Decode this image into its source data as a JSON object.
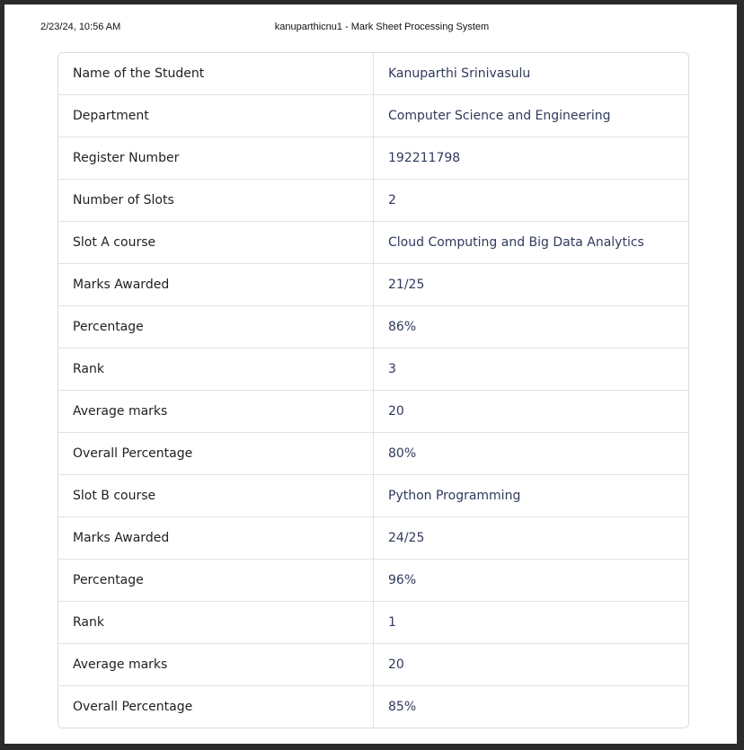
{
  "print_header": {
    "datetime": "2/23/24, 10:56 AM",
    "title": "kanuparthicnu1 - Mark Sheet Processing System"
  },
  "rows": [
    {
      "label": "Name of the Student",
      "value": "Kanuparthi Srinivasulu"
    },
    {
      "label": "Department",
      "value": "Computer Science and Engineering"
    },
    {
      "label": "Register Number",
      "value": "192211798"
    },
    {
      "label": "Number of Slots",
      "value": "2"
    },
    {
      "label": "Slot A course",
      "value": "Cloud Computing and Big Data Analytics"
    },
    {
      "label": "Marks Awarded",
      "value": "21/25"
    },
    {
      "label": "Percentage",
      "value": "86%"
    },
    {
      "label": "Rank",
      "value": "3"
    },
    {
      "label": "Average marks",
      "value": "20"
    },
    {
      "label": "Overall Percentage",
      "value": "80%"
    },
    {
      "label": "Slot B course",
      "value": "Python Programming"
    },
    {
      "label": "Marks Awarded",
      "value": "24/25"
    },
    {
      "label": "Percentage",
      "value": "96%"
    },
    {
      "label": "Rank",
      "value": "1"
    },
    {
      "label": "Average marks",
      "value": "20"
    },
    {
      "label": "Overall Percentage",
      "value": "85%"
    }
  ]
}
